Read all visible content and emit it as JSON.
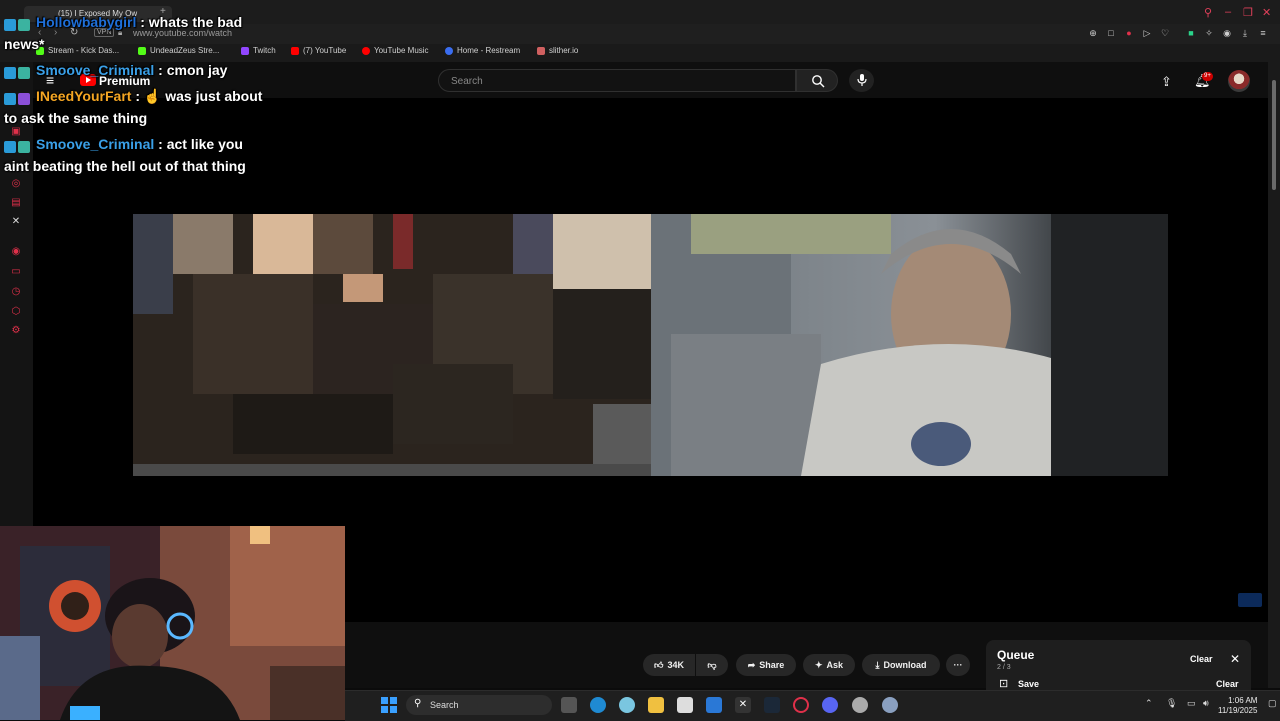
{
  "browser": {
    "tab_title": "(15) I Exposed My Ow",
    "vpn_label": "VPN",
    "url": "www.youtube.com/watch",
    "bookmarks": [
      {
        "label": "Stream - Kick Das...",
        "color": "#53fc18"
      },
      {
        "label": "UndeadZeus Stre...",
        "color": "#53fc18"
      },
      {
        "label": "Twitch",
        "color": "#9146ff"
      },
      {
        "label": "(7) YouTube",
        "color": "#ff0000"
      },
      {
        "label": "YouTube Music",
        "color": "#ff0000"
      },
      {
        "label": "Home - Restream",
        "color": "#3a6df0"
      },
      {
        "label": "slither.io",
        "color": "#d06060"
      }
    ]
  },
  "youtube": {
    "premium_label": "Premium",
    "search_placeholder": "Search",
    "notification_count": "9+"
  },
  "chat": [
    {
      "user": "Hollowbabygirl",
      "user_color": "#1e6fd9",
      "sep": " : ",
      "text": "whats the bad",
      "cont": "news*"
    },
    {
      "user": "Smoove_Criminal",
      "user_color": "#3aa0e8",
      "sep": " : ",
      "text": "cmon jay",
      "cont": ""
    },
    {
      "user": "INeedYourFart",
      "user_color": "#f5a623",
      "sep": " : ",
      "text": "☝️ was just about",
      "cont": "to ask the same thing"
    },
    {
      "user": "Smoove_Criminal",
      "user_color": "#3aa0e8",
      "sep": " : ",
      "text": "act like you",
      "cont": "aint beating the hell out of that thing"
    }
  ],
  "video_actions": {
    "like_count": "34K",
    "share_label": "Share",
    "ask_label": "Ask",
    "download_label": "Download",
    "more_label": "···"
  },
  "queue": {
    "title": "Queue",
    "position": "2 / 3",
    "clear_label": "Clear",
    "save_label": "Save",
    "clear2_label": "Clear"
  },
  "taskbar": {
    "search_label": "Search",
    "time": "1:06 AM",
    "date": "11/19/2025"
  }
}
